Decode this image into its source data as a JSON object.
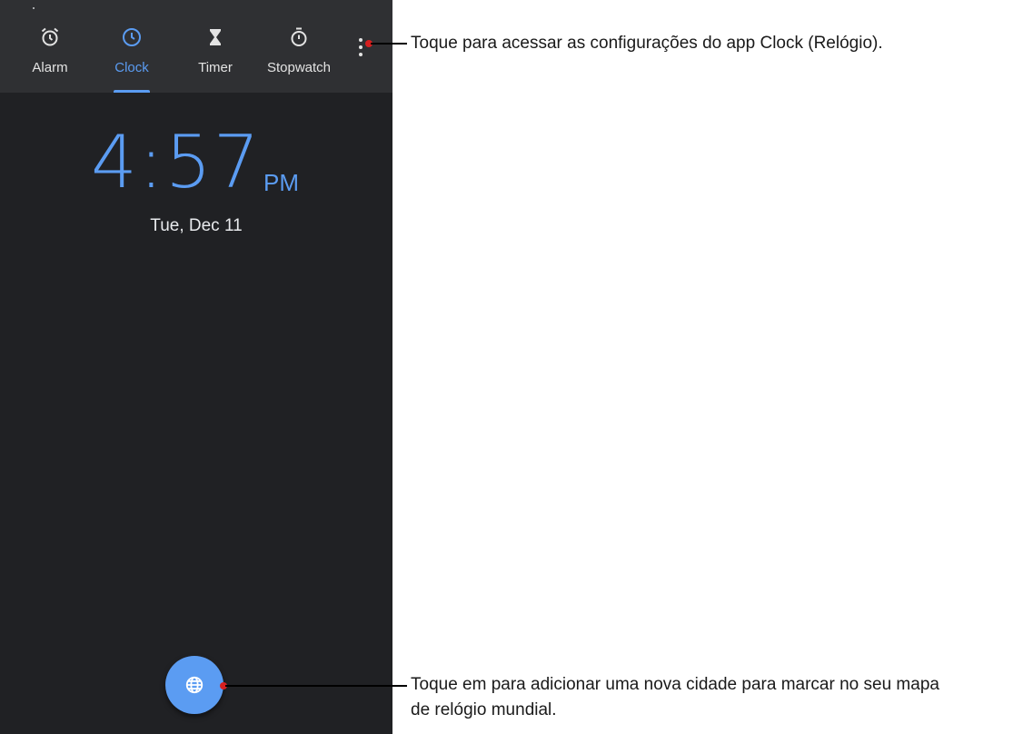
{
  "tabs": [
    {
      "label": "Alarm",
      "icon": "alarm-icon",
      "active": false
    },
    {
      "label": "Clock",
      "icon": "clock-icon",
      "active": true
    },
    {
      "label": "Timer",
      "icon": "hourglass-icon",
      "active": false
    },
    {
      "label": "Stopwatch",
      "icon": "stopwatch-icon",
      "active": false
    }
  ],
  "more_menu": {
    "icon": "more-vert-icon"
  },
  "clock": {
    "time": "4:57",
    "ampm": "PM",
    "date": "Tue, Dec 11"
  },
  "fab": {
    "icon": "globe-icon"
  },
  "annotations": {
    "settings": "Toque para acessar as configurações do app Clock (Relógio).",
    "world_clock_line1": "Toque em para adicionar uma nova cidade para marcar no seu mapa",
    "world_clock_line2": "de relógio mundial."
  },
  "colors": {
    "accent": "#5b9cf2",
    "background": "#202124",
    "tabbar": "#2f3033",
    "annotation_marker": "#d61f1f"
  }
}
